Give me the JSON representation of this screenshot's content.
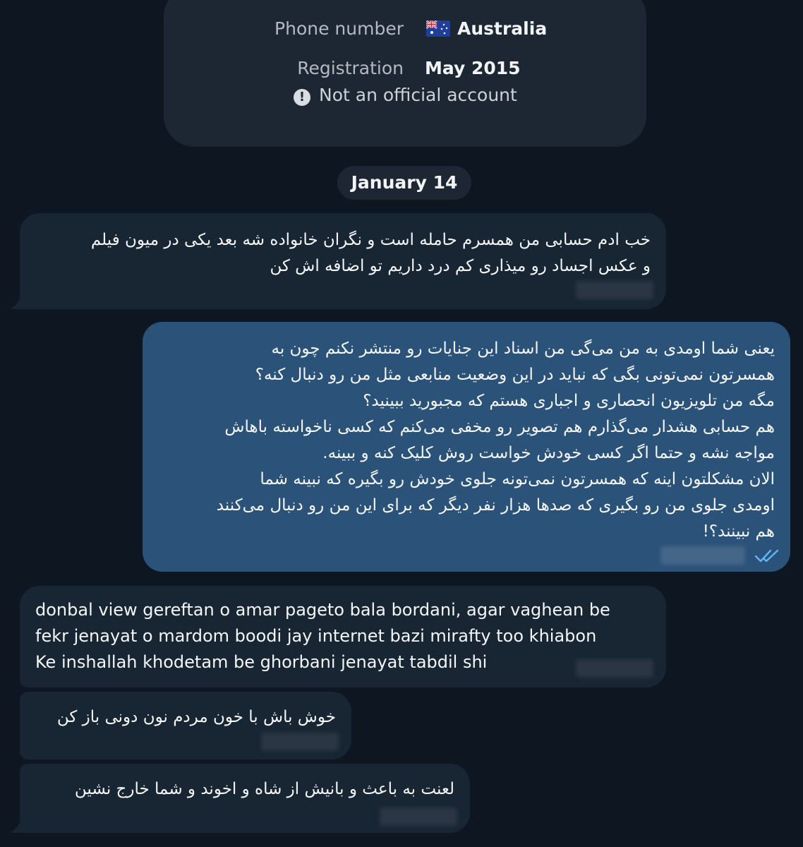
{
  "profile": {
    "phone_label": "Phone number",
    "phone_value": "Australia",
    "phone_flag": "australia-flag-icon",
    "registration_label": "Registration",
    "registration_value": "May 2015",
    "official_notice": "Not an official account"
  },
  "date_separator": "January 14",
  "messages": [
    {
      "direction": "in",
      "text": "خب ادم حسابی من همسرم حامله است و نگران خانواده شه بعد یکی در میون فیلم\nو عکس اجساد رو میذاری کم درد داریم تو اضافه اش کن"
    },
    {
      "direction": "out",
      "text": "یعنی شما اومدی به من می‌گی من اسناد این جنایات رو منتشر نکنم چون به\nهمسرتون نمی‌تونی بگی که نباید در این وضعیت منابعی مثل من رو دنبال کنه؟\nمگه من تلویزیون انحصاری و اجباری هستم که مجبورید ببینید؟\nهم حسابی هشدار می‌گذارم هم تصویر رو مخفی می‌کنم که کسی ناخواسته باهاش\nمواجه نشه و حتما اگر کسی خودش خواست روش کلیک کنه و ببینه.\nالان مشکلتون اینه که همسرتون نمی‌تونه جلوی خودش رو بگیره که نبینه شما\nاومدی جلوی من رو بگیری که صدها هزار نفر دیگر که برای این من رو دنبال می‌کنند\nهم نبینند؟!",
      "status": "read"
    },
    {
      "direction": "in",
      "text": "donbal view gereftan o amar pageto bala bordani, agar vaghean be\nfekr jenayat o mardom boodi jay internet bazi mirafty too khiabon\nKe inshallah khodetam be ghorbani jenayat tabdil shi"
    },
    {
      "direction": "in",
      "text": "خوش باش با خون مردم نون دونی باز کن"
    },
    {
      "direction": "in",
      "text": "لعنت به باعث و بانیش از شاه و اخوند و شما خارج نشین"
    }
  ],
  "colors": {
    "background": "#0e1621",
    "incoming_bubble": "#182533",
    "outgoing_bubble": "#2b5278",
    "read_check": "#5eb5f7"
  }
}
